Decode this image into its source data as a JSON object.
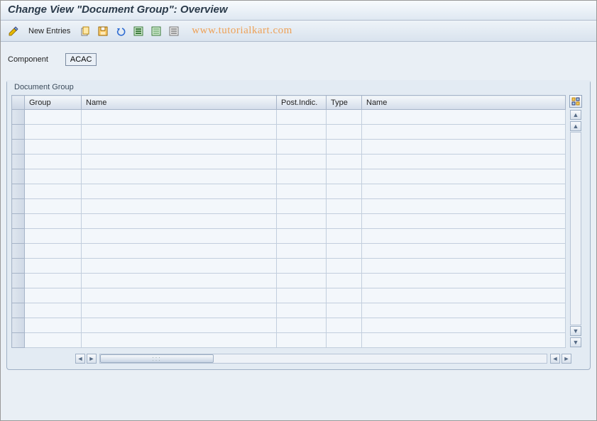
{
  "title": "Change View \"Document Group\": Overview",
  "toolbar": {
    "new_entries_label": "New Entries"
  },
  "watermark": "www.tutorialkart.com",
  "form": {
    "component_label": "Component",
    "component_value": "ACAC"
  },
  "group": {
    "title": "Document Group",
    "columns": {
      "c1": "Group",
      "c2": "Name",
      "c3": "Post.Indic.",
      "c4": "Type",
      "c5": "Name"
    },
    "rows": [
      {
        "c1": "",
        "c2": "",
        "c3": "",
        "c4": "",
        "c5": ""
      },
      {
        "c1": "",
        "c2": "",
        "c3": "",
        "c4": "",
        "c5": ""
      },
      {
        "c1": "",
        "c2": "",
        "c3": "",
        "c4": "",
        "c5": ""
      },
      {
        "c1": "",
        "c2": "",
        "c3": "",
        "c4": "",
        "c5": ""
      },
      {
        "c1": "",
        "c2": "",
        "c3": "",
        "c4": "",
        "c5": ""
      },
      {
        "c1": "",
        "c2": "",
        "c3": "",
        "c4": "",
        "c5": ""
      },
      {
        "c1": "",
        "c2": "",
        "c3": "",
        "c4": "",
        "c5": ""
      },
      {
        "c1": "",
        "c2": "",
        "c3": "",
        "c4": "",
        "c5": ""
      },
      {
        "c1": "",
        "c2": "",
        "c3": "",
        "c4": "",
        "c5": ""
      },
      {
        "c1": "",
        "c2": "",
        "c3": "",
        "c4": "",
        "c5": ""
      },
      {
        "c1": "",
        "c2": "",
        "c3": "",
        "c4": "",
        "c5": ""
      },
      {
        "c1": "",
        "c2": "",
        "c3": "",
        "c4": "",
        "c5": ""
      },
      {
        "c1": "",
        "c2": "",
        "c3": "",
        "c4": "",
        "c5": ""
      },
      {
        "c1": "",
        "c2": "",
        "c3": "",
        "c4": "",
        "c5": ""
      },
      {
        "c1": "",
        "c2": "",
        "c3": "",
        "c4": "",
        "c5": ""
      },
      {
        "c1": "",
        "c2": "",
        "c3": "",
        "c4": "",
        "c5": ""
      }
    ]
  }
}
